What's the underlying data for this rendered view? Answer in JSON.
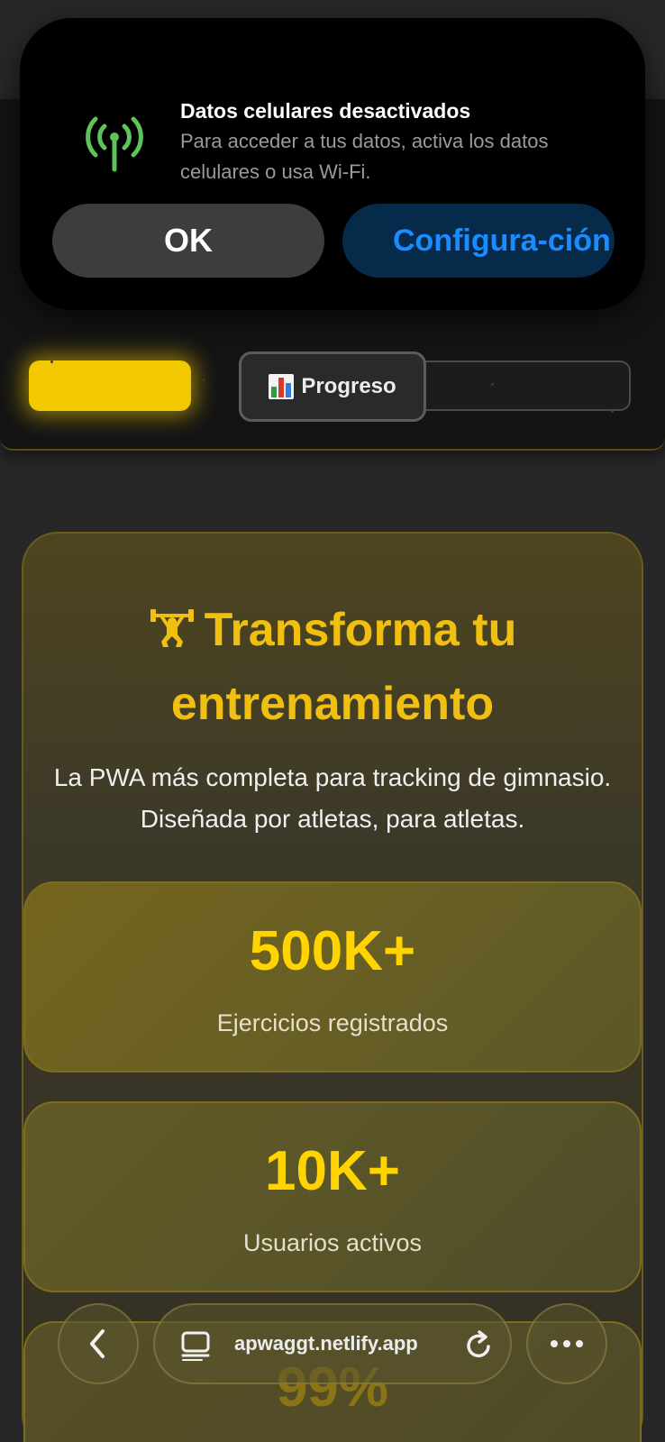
{
  "alert": {
    "title": "Datos celulares desactivados",
    "message": "Para acceder a tus datos, activa los datos celulares o usa Wi-Fi.",
    "ok_label": "OK",
    "settings_label": "Configura-ción",
    "icon": "cellular-signal-icon",
    "icon_color": "#5dc35a"
  },
  "header": {
    "progress_button": {
      "label": "Progreso",
      "icon": "bar-chart-icon"
    }
  },
  "hero": {
    "title": "Transforma tu entrenamiento",
    "title_icon": "weightlifter-icon",
    "subtitle": "La PWA más completa para tracking de gimnasio. Diseñada por atletas, para atletas.",
    "accent_color": "#f0bf10"
  },
  "stats": [
    {
      "value": "500K+",
      "label": "Ejercicios registrados"
    },
    {
      "value": "10K+",
      "label": "Usuarios activos"
    },
    {
      "value": "99%",
      "label": ""
    }
  ],
  "browser": {
    "url": "apwaggt.netlify.app",
    "back_icon": "chevron-left-icon",
    "tabs_icon": "tabs-icon",
    "reload_icon": "reload-icon",
    "more_icon": "more-horizontal-icon"
  }
}
